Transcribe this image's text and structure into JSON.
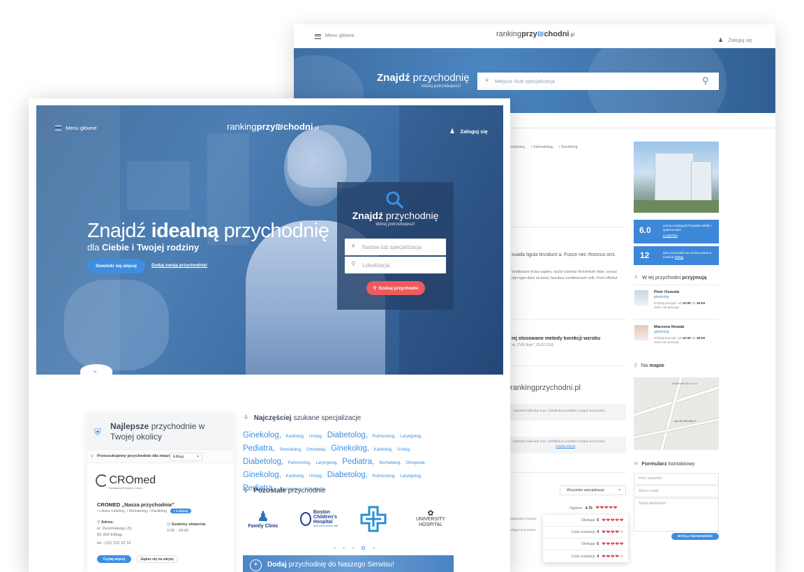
{
  "back": {
    "nav": {
      "menu_label": "Menu główne",
      "login_label": "Zaloguj się"
    },
    "logo": {
      "part1": "ranking",
      "part2": "przy",
      "part3": "chodni",
      "tld": ".pl"
    },
    "hero": {
      "title_bold": "Znajdź",
      "title_light": "przychodnię",
      "subtitle": "której potrzebujesz!",
      "search_placeholder": "Miejsce i/lub specjalizacja"
    },
    "breadcrumb": {
      "items": [
        "rodzinny,",
        "Stomatolog,",
        "Kardiolog"
      ]
    },
    "content": {
      "text1": "suada ligula tincidunt a. Fusce nec rhoncus orci.",
      "text2": "Vestibulum lectus sapien, auctor pulvinar fermentum vitae, cursus",
      "text3": "rper eget diam sit amet, faucibus condimentum velit. Proin efficitur",
      "article_title": "iej stosowane metody korekcji wzroku",
      "article_meta": "za „TVN Style”, 25.02.2015",
      "site_heading": "rankingprzychodni.pl",
      "comment1": "nascetur ridiculus mus. Vestibulum porttitor congue accumsan.",
      "comment2": "nascetur ridiculus mus. Vestibulum porttitor congue accumsan.",
      "read_more": "Czytaj więcej",
      "dropdown_label": "Wszystkie specjalizacje",
      "partial1": "parturient montes,",
      "partial2": "ongue accumsan."
    },
    "ratings": {
      "overall_label": "Ogólem",
      "overall_value": "4.75",
      "rows": [
        {
          "label": "Obsługa",
          "value": "5",
          "filled": 5
        },
        {
          "label": "Czas realizacji",
          "value": "4",
          "filled": 4
        },
        {
          "label": "Obsługa",
          "value": "5",
          "filled": 5
        },
        {
          "label": "Czas realizacji",
          "value": "4",
          "filled": 4
        }
      ]
    },
    "sidebar": {
      "score1": {
        "value": "6.0",
        "text": "ocena w kategorii Prywatne kliniki i społeczności",
        "votes": "(4 głosów)"
      },
      "score2": {
        "value": "12",
        "text": "tyle przychodni ma niższą ocenę w mieście",
        "city": "Elbląg"
      },
      "doctors_heading_light": "W tej przychodni",
      "doctors_heading_bold": "przyjmują",
      "doctors": [
        {
          "name": "Piotr Osmoła",
          "specialty": "ginekolog",
          "hours_label": "Dzisiaj pracuje:",
          "from": "od",
          "start": "12:00",
          "to": "do",
          "end": "16:00",
          "tomorrow": "Jutro nie pracuje."
        },
        {
          "name": "Marzena Nowak",
          "specialty": "ginekolog",
          "hours_label": "Dzisiaj pracuje:",
          "from": "od",
          "start": "12:00",
          "to": "do",
          "end": "16:00",
          "tomorrow": "Jutro nie pracuje."
        }
      ],
      "map_heading_light": "Na",
      "map_heading_bold": "mapie",
      "map_label1": "Dworcowa Sp. z o.o.",
      "map_label2": "AN 3D PROJECT",
      "form_heading_bold": "Formularz",
      "form_heading_light": "kontaktowy",
      "form_name": "Imię i nazwisko",
      "form_email": "Adres e-mail",
      "form_message": "Twoja wiadomość",
      "form_submit": "WYŚLIJ WIADOMOŚĆ"
    }
  },
  "front": {
    "nav": {
      "menu_label": "Menu główne",
      "login_label": "Zaloguj się"
    },
    "hero": {
      "title_light": "Znajdź",
      "title_bold": "idealną",
      "title_rest": "przychodnię",
      "subtitle_light": "dla",
      "subtitle_bold": "Ciebie i Twojej rodziny",
      "learn_more": "Dowiedz się więcej",
      "add_clinic_link": "Dodaj swoją przychodnię!"
    },
    "search": {
      "title_bold": "Znajdź",
      "title_light": "przychodnię",
      "subtitle": "której potrzebujesz!",
      "name_placeholder": "Nazwa lub specjalizacja",
      "location_placeholder": "Lokalizacja",
      "submit": "Szukaj przychodni"
    },
    "best": {
      "heading_bold": "Najlepsze",
      "heading_light": "przychodnie w Twojej okolicy",
      "city_label": "Przeszukujemy przychodnie dla miasta:",
      "city_value": "Elbląg",
      "clinic_logo": "CROmed",
      "clinic_logo_sub": "Translational Research Centers",
      "clinic_name": "CROMED „Nasza przychodnia”",
      "clinic_specs": [
        "Lekarz rodzinny,",
        "Stomatolog,",
        "Kardiolog"
      ],
      "more_badge": "+ 5 więcej",
      "address_label": "Adres:",
      "address_street": "ul. Żeromskiego 2b,",
      "address_city": "82-300 Elbląg",
      "address_phone": "tel.: (22) 232 32 32",
      "hours_label": "Godziny otwarcia:",
      "hours_value": "9:00 - 18:00",
      "read_more": "Czytaj więcej",
      "book_visit": "Zapisz się na wizytę"
    },
    "specs": {
      "heading_bold": "Najczęściej",
      "heading_light": "szukane specjalizacje",
      "tags": [
        {
          "t": "Ginekolog,",
          "s": "l"
        },
        {
          "t": "Kardiolog,",
          "s": "s"
        },
        {
          "t": "Urolog,",
          "s": "s"
        },
        {
          "t": "Diabetolog,",
          "s": "l"
        },
        {
          "t": "Pulmonolog,",
          "s": "s"
        },
        {
          "t": "Laryngolog,",
          "s": "s"
        },
        {
          "t": "Pediatra,",
          "s": "l"
        },
        {
          "t": "Stomatolog,",
          "s": "s"
        },
        {
          "t": "Ortorpeda,",
          "s": "s"
        },
        {
          "t": "Ginekolog,",
          "s": "l"
        },
        {
          "t": "Kardiolog,",
          "s": "s"
        },
        {
          "t": "Urolog,",
          "s": "s"
        },
        {
          "t": "Diabetolog,",
          "s": "l"
        },
        {
          "t": "Pulmonolog,",
          "s": "s"
        },
        {
          "t": "Laryngolog,",
          "s": "s"
        },
        {
          "t": "Pediatra,",
          "s": "l"
        },
        {
          "t": "Stomatolog,",
          "s": "s"
        },
        {
          "t": "Ortorpeda,",
          "s": "s"
        },
        {
          "t": "Ginekolog,",
          "s": "l"
        },
        {
          "t": "Kardiolog,",
          "s": "s"
        },
        {
          "t": "Urolog,",
          "s": "s"
        },
        {
          "t": "Diabetolog,",
          "s": "l"
        },
        {
          "t": "Pulmonolog,",
          "s": "s"
        },
        {
          "t": "Laryngolog,",
          "s": "s"
        },
        {
          "t": "Pediatra,",
          "s": "l"
        },
        {
          "t": "Stomatolog,",
          "s": "s"
        },
        {
          "t": "Ortorpeda",
          "s": "s"
        }
      ]
    },
    "others": {
      "heading_bold": "Pozostałe",
      "heading_light": "przychodnie",
      "logos": [
        {
          "name": "Family Clinic"
        },
        {
          "name": "Boston Children's Hospital",
          "line1": "Boston",
          "line2": "Children's",
          "line3": "Hospital",
          "tagline": "Until every child is well"
        },
        {
          "name": "cross-logo"
        },
        {
          "name": "University Hospital",
          "line1": "UNIVERSITY",
          "line2": "HOSPITAL"
        }
      ]
    },
    "add_banner": {
      "bold": "Dodaj",
      "light": "przychodnię do Naszego Serwisu!"
    }
  },
  "colors": {
    "accent": "#3d8ee0",
    "red": "#ef5a5e",
    "hero_blue": "#3f72aa",
    "heart": "#e2484c"
  }
}
